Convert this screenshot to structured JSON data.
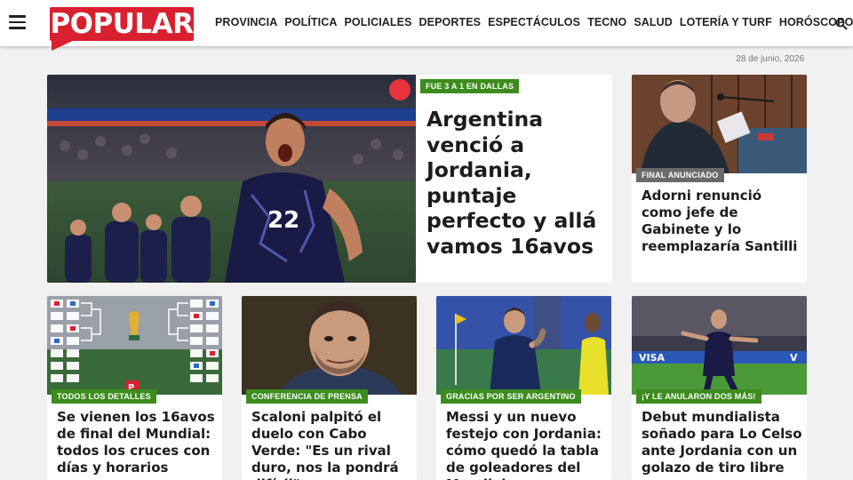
{
  "brand": {
    "logo_text": "POPULAR",
    "color": "#d8202f"
  },
  "nav": [
    "PROVINCIA",
    "POLÍTICA",
    "POLICIALES",
    "DEPORTES",
    "ESPECTÁCULOS",
    "TECNO",
    "SALUD",
    "LOTERÍA Y TURF",
    "HORÓSCOPO"
  ],
  "date": "28 de junio, 2026",
  "main_story": {
    "tag": "FUE 3 A 1 EN DALLAS",
    "headline": "Argentina venció a Jordania, puntaje perfecto y allá vamos 16avos",
    "player_number": "22"
  },
  "side_story": {
    "tag": "FINAL ANUNCIADO",
    "headline": "Adorni renunció como jefe de Gabinete y lo reemplazaría Santilli"
  },
  "cards": [
    {
      "tag": "TODOS LOS DETALLES",
      "headline": "Se vienen los 16avos de final del Mundial: todos los cruces con días y horarios"
    },
    {
      "tag": "CONFERENCIA DE PRENSA",
      "headline": "Scaloni palpitó el duelo con Cabo Verde: \"Es un rival duro, nos la pondrá difícil\""
    },
    {
      "tag": "GRACIAS POR SER ARGENTINO",
      "headline": "Messi y un nuevo festejo con Jordania: cómo quedó la tabla de goleadores del Mundial"
    },
    {
      "tag": "¡Y LE ANULARON DOS MÁS!",
      "headline": "Debut mundialista soñado para Lo Celso ante Jordania con un golazo de tiro libre"
    }
  ],
  "colors": {
    "tag_green": "#3c8c1e",
    "tag_gray": "#6a6a6a",
    "background": "#f1f1f1"
  }
}
